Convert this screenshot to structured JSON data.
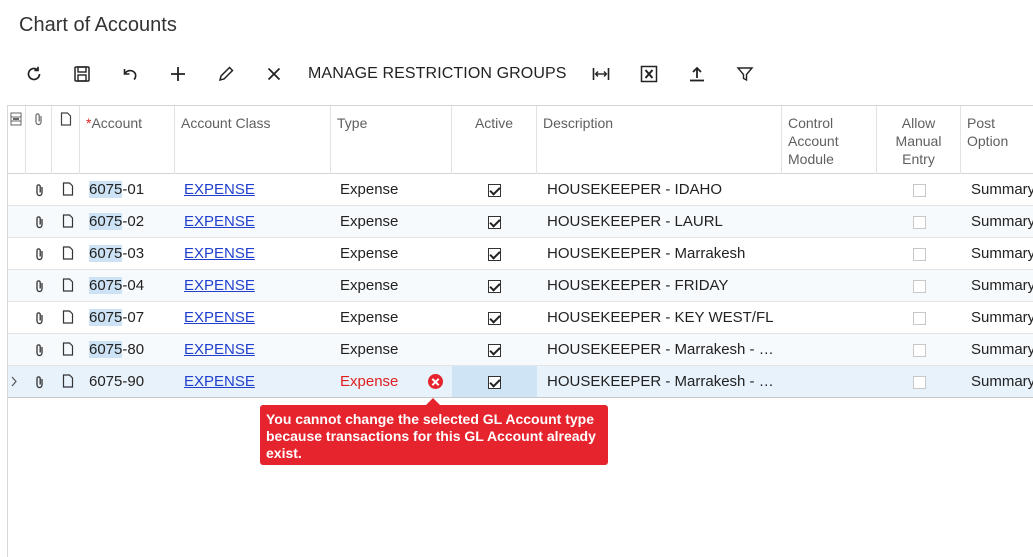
{
  "page": {
    "title": "Chart of Accounts"
  },
  "toolbar": {
    "refresh_icon": "refresh-icon",
    "save_icon": "save-icon",
    "undo_icon": "undo-icon",
    "add_icon": "plus-icon",
    "edit_icon": "pencil-icon",
    "delete_icon": "close-icon",
    "manage_label": "MANAGE RESTRICTION GROUPS",
    "fit_icon": "fit-columns-icon",
    "excel_icon": "excel-export-icon",
    "upload_icon": "upload-icon",
    "filter_icon": "filter-icon"
  },
  "grid": {
    "headers": {
      "account": "Account",
      "account_class": "Account Class",
      "type": "Type",
      "active": "Active",
      "description": "Description",
      "control_account": [
        "Control",
        "Account",
        "Module"
      ],
      "allow_manual": [
        "Allow",
        "Manual",
        "Entry"
      ],
      "post_option": [
        "Post",
        "Option"
      ]
    },
    "rows": [
      {
        "account_prefix": "6075",
        "account_suffix": "-01",
        "account_class": "EXPENSE",
        "type": "Expense",
        "active": true,
        "description": "HOUSEKEEPER - IDAHO",
        "allow_manual": false,
        "post_option": "Summary"
      },
      {
        "account_prefix": "6075",
        "account_suffix": "-02",
        "account_class": "EXPENSE",
        "type": "Expense",
        "active": true,
        "description": "HOUSEKEEPER - LAURL",
        "allow_manual": false,
        "post_option": "Summary"
      },
      {
        "account_prefix": "6075",
        "account_suffix": "-03",
        "account_class": "EXPENSE",
        "type": "Expense",
        "active": true,
        "description": "HOUSEKEEPER - Marrakesh",
        "allow_manual": false,
        "post_option": "Summary"
      },
      {
        "account_prefix": "6075",
        "account_suffix": "-04",
        "account_class": "EXPENSE",
        "type": "Expense",
        "active": true,
        "description": "HOUSEKEEPER - FRIDAY",
        "allow_manual": false,
        "post_option": "Summary"
      },
      {
        "account_prefix": "6075",
        "account_suffix": "-07",
        "account_class": "EXPENSE",
        "type": "Expense",
        "active": true,
        "description": "HOUSEKEEPER - KEY WEST/FL",
        "allow_manual": false,
        "post_option": "Summary"
      },
      {
        "account_prefix": "6075",
        "account_suffix": "-80",
        "account_class": "EXPENSE",
        "type": "Expense",
        "active": true,
        "description": "HOUSEKEEPER - Marrakesh - …",
        "allow_manual": false,
        "post_option": "Summary"
      },
      {
        "account_prefix": "",
        "account_suffix": "6075-90",
        "account_class": "EXPENSE",
        "type": "Expense",
        "active": true,
        "description": "HOUSEKEEPER - Marrakesh - …",
        "allow_manual": false,
        "post_option": "Summary"
      }
    ]
  },
  "error": {
    "message": "You cannot change the selected GL Account type because transactions for this GL Account already exist.",
    "color": "#e5242d"
  },
  "colors": {
    "link": "#1f3fcc",
    "error": "#e02020",
    "selected_row": "#e8f2fb"
  }
}
